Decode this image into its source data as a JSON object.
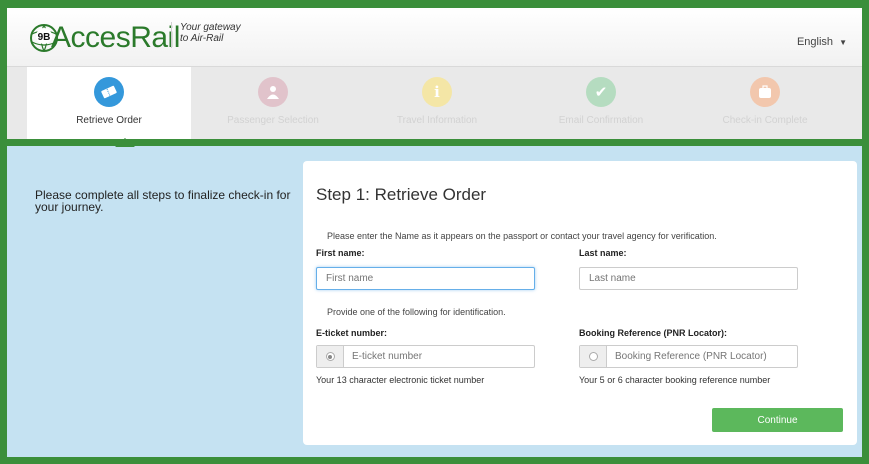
{
  "header": {
    "logo_text": "AccesRail",
    "logo_badge": "9B",
    "tagline_line1": "Your gateway",
    "tagline_line2": "to Air-Rail",
    "language": "English"
  },
  "steps": [
    {
      "label": "Retrieve Order",
      "icon": "ticket-icon",
      "color": "#3498db",
      "active": true
    },
    {
      "label": "Passenger Selection",
      "icon": "user-icon",
      "color": "#b0405a",
      "active": false
    },
    {
      "label": "Travel Information",
      "icon": "info-icon",
      "color": "#f1c40f",
      "active": false
    },
    {
      "label": "Email Confirmation",
      "icon": "check-icon",
      "color": "#27ae60",
      "active": false
    },
    {
      "label": "Check-in Complete",
      "icon": "luggage-icon",
      "color": "#e67e22",
      "active": false
    }
  ],
  "intro": "Please complete all steps to finalize check-in for your journey.",
  "form": {
    "title": "Step 1: Retrieve Order",
    "name_note": "Please enter the Name as it appears on the passport or contact your travel agency for verification.",
    "first_name_label": "First name:",
    "first_name_placeholder": "First name",
    "last_name_label": "Last name:",
    "last_name_placeholder": "Last name",
    "id_note": "Provide one of the following for identification.",
    "eticket_label": "E-ticket number:",
    "eticket_placeholder": "E-ticket number",
    "eticket_help": "Your 13 character electronic ticket number",
    "pnr_label": "Booking Reference (PNR Locator):",
    "pnr_placeholder": "Booking Reference (PNR Locator)",
    "pnr_help": "Your 5 or 6 character booking reference number",
    "continue_label": "Continue"
  }
}
